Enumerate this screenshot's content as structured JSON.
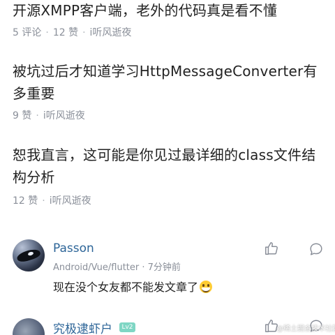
{
  "articles": [
    {
      "title": "开源XMPP客户端，老外的代码真是看不懂",
      "comments": "5 评论",
      "likes": "12 赞",
      "author": "i听风逝夜"
    },
    {
      "title": "被坑过后才知道学习HttpMessageConverter有多重要",
      "likes": "9 赞",
      "author": "i听风逝夜"
    },
    {
      "title": "恕我直言，这可能是你见过最详细的class文件结构分析",
      "likes": "12 赞",
      "author": "i听风逝夜"
    }
  ],
  "meta_separator": "·",
  "comments": [
    {
      "user": "Passon",
      "tags": "Android/Vue/flutter",
      "time": "7分钟前",
      "text": "现在没个女友都不能发文章了"
    },
    {
      "user": "究极逮虾户",
      "level": "Lv2"
    }
  ],
  "watermark": "@稀土掘金技术社区",
  "icons": {
    "like": "thumbs-up-icon",
    "reply": "comment-bubble-icon",
    "emoji": "grinning-face-emoji-icon"
  },
  "colors": {
    "username": "#2d6598",
    "meta_gray": "#8a8f99",
    "level_badge": "#7fd6c4"
  }
}
